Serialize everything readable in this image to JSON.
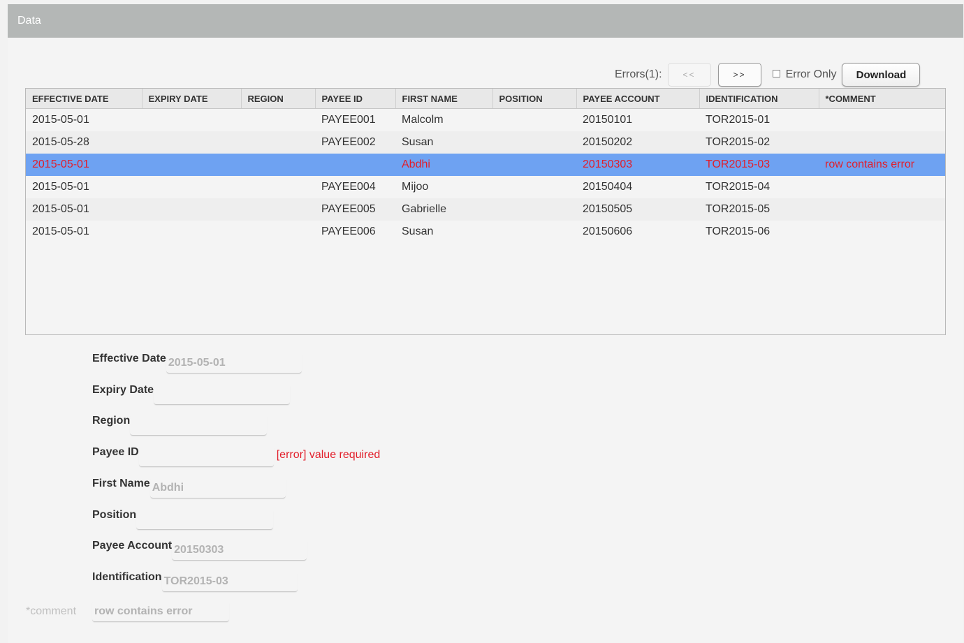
{
  "panel": {
    "title": "Data"
  },
  "toolbar": {
    "errors_label": "Errors(1):",
    "prev_label": "<<",
    "next_label": ">>",
    "error_only_label": "Error Only",
    "download_label": "Download"
  },
  "grid": {
    "columns": [
      "EFFECTIVE DATE",
      "EXPIRY DATE",
      "REGION",
      "PAYEE ID",
      "FIRST NAME",
      "POSITION",
      "PAYEE ACCOUNT",
      "IDENTIFICATION",
      "*COMMENT"
    ],
    "rows": [
      [
        "2015-05-01",
        "",
        "",
        "PAYEE001",
        "Malcolm",
        "",
        "20150101",
        "TOR2015-01",
        ""
      ],
      [
        "2015-05-28",
        "",
        "",
        "PAYEE002",
        "Susan",
        "",
        "20150202",
        "TOR2015-02",
        ""
      ],
      [
        "2015-05-01",
        "",
        "",
        "",
        "Abdhi",
        "",
        "20150303",
        "TOR2015-03",
        "row contains error"
      ],
      [
        "2015-05-01",
        "",
        "",
        "PAYEE004",
        "Mijoo",
        "",
        "20150404",
        "TOR2015-04",
        ""
      ],
      [
        "2015-05-01",
        "",
        "",
        "PAYEE005",
        "Gabrielle",
        "",
        "20150505",
        "TOR2015-05",
        ""
      ],
      [
        "2015-05-01",
        "",
        "",
        "PAYEE006",
        "Susan",
        "",
        "20150606",
        "TOR2015-06",
        ""
      ]
    ],
    "selected_row": 2
  },
  "form": {
    "effective_date": {
      "label": "Effective Date",
      "value": "2015-05-01"
    },
    "expiry_date": {
      "label": "Expiry Date",
      "value": ""
    },
    "region": {
      "label": "Region",
      "value": ""
    },
    "payee_id": {
      "label": "Payee ID",
      "value": "",
      "error": "[error] value required"
    },
    "first_name": {
      "label": "First Name",
      "value": "Abdhi"
    },
    "position": {
      "label": "Position",
      "value": ""
    },
    "payee_account": {
      "label": "Payee Account",
      "value": "20150303"
    },
    "identification": {
      "label": "Identification",
      "value": "TOR2015-03"
    },
    "comment": {
      "label": "*comment",
      "value": "row contains error"
    }
  },
  "colors": {
    "selected_row": "#6ea2f2",
    "error_text": "#e21e2a",
    "header": "#b4b7b6"
  }
}
